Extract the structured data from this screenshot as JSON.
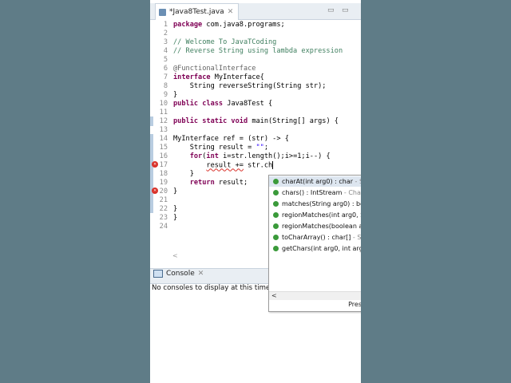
{
  "editor": {
    "tab_title": "*Java8Test.java",
    "close_symbol": "✕",
    "lines": [
      {
        "n": "1",
        "code": "package com.java8.programs;"
      },
      {
        "n": "2",
        "code": ""
      },
      {
        "n": "3",
        "code": "// Welcome To JavaTCoding"
      },
      {
        "n": "4",
        "code": "// Reverse String using lambda expression"
      },
      {
        "n": "5",
        "code": ""
      },
      {
        "n": "6",
        "code": "@FunctionalInterface"
      },
      {
        "n": "7",
        "code": "interface MyInterface{"
      },
      {
        "n": "8",
        "code": "    String reverseString(String str);"
      },
      {
        "n": "9",
        "code": "}"
      },
      {
        "n": "10",
        "code": "public class Java8Test {"
      },
      {
        "n": "11",
        "code": ""
      },
      {
        "n": "12",
        "code": "public static void main(String[] args) {"
      },
      {
        "n": "13",
        "code": ""
      },
      {
        "n": "14",
        "code": "MyInterface ref = (str) -> {"
      },
      {
        "n": "15",
        "code": "    String result = \"\";"
      },
      {
        "n": "16",
        "code": "    for(int i=str.length();i>=1;i--) {"
      },
      {
        "n": "17",
        "code": "        result += str.ch"
      },
      {
        "n": "18",
        "code": "    }"
      },
      {
        "n": "19",
        "code": "    return result;"
      },
      {
        "n": "20",
        "code": "}"
      },
      {
        "n": "21",
        "code": ""
      },
      {
        "n": "22",
        "code": "}"
      },
      {
        "n": "23",
        "code": "}"
      },
      {
        "n": "24",
        "code": ""
      }
    ]
  },
  "autocomplete": {
    "items": [
      {
        "name": "charAt(int arg0) : char",
        "detail": " - St"
      },
      {
        "name": "chars() : IntStream",
        "detail": " - Char"
      },
      {
        "name": "matches(String arg0) : boo",
        "detail": ""
      },
      {
        "name": "regionMatches(int arg0, S",
        "detail": ""
      },
      {
        "name": "regionMatches(boolean a",
        "detail": ""
      },
      {
        "name": "toCharArray() : char[]",
        "detail": " - Str"
      },
      {
        "name": "getChars(int arg0, int arg1",
        "detail": ""
      }
    ],
    "footer": "Pres"
  },
  "console": {
    "tab_label": "Console",
    "close_symbol": "✕",
    "message": "No consoles to display at this time."
  },
  "colors": {
    "background": "#5f7c87",
    "keyword": "#7f0055",
    "comment": "#3f7f5f",
    "string": "#2a00ff"
  }
}
